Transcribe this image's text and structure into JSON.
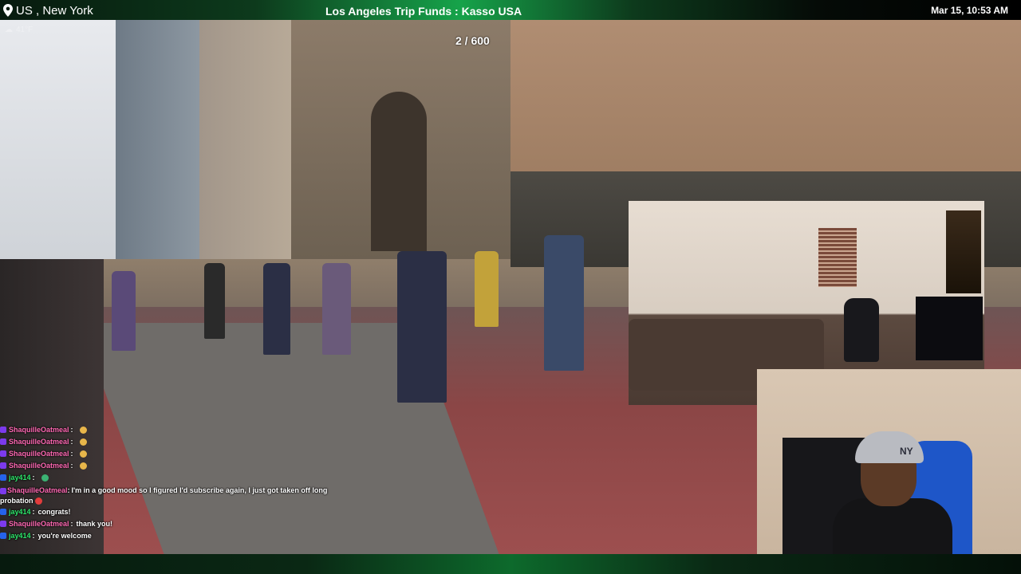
{
  "overlay": {
    "location": "US , New York",
    "title": "Los Angeles Trip Funds : Kasso USA",
    "datetime": "Mar 15, 10:53 AM",
    "weather": "41°F",
    "counter": "2 / 600"
  },
  "facecam": {
    "cap_logo": "NY"
  },
  "chat": [
    {
      "user": "ShaquilleOatmeal",
      "sep": ":",
      "text": "",
      "color": "#ff69b4"
    },
    {
      "user": "ShaquilleOatmeal",
      "sep": ":",
      "text": "",
      "color": "#ff69b4"
    },
    {
      "user": "ShaquilleOatmeal",
      "sep": ":",
      "text": "",
      "color": "#ff69b4"
    },
    {
      "user": "ShaquilleOatmeal",
      "sep": ":",
      "text": "",
      "color": "#ff69b4"
    },
    {
      "user": "jay414",
      "sep": ":",
      "text": "",
      "color": "#2ee86c"
    },
    {
      "user": "ShaquilleOatmeal",
      "sep": ":",
      "text": "I'm in a good mood so I figured I'd subscribe again, I just got taken off long probation",
      "color": "#ff69b4"
    },
    {
      "user": "jay414",
      "sep": ":",
      "text": "congrats!",
      "color": "#2ee86c"
    },
    {
      "user": "ShaquilleOatmeal",
      "sep": ":",
      "text": "thank you!",
      "color": "#ff69b4"
    },
    {
      "user": "jay414",
      "sep": ":",
      "text": "you're welcome",
      "color": "#2ee86c"
    }
  ],
  "colors": {
    "accent_green": "#16a34a",
    "user_pink": "#ff69b4",
    "user_green": "#2ee86c"
  }
}
